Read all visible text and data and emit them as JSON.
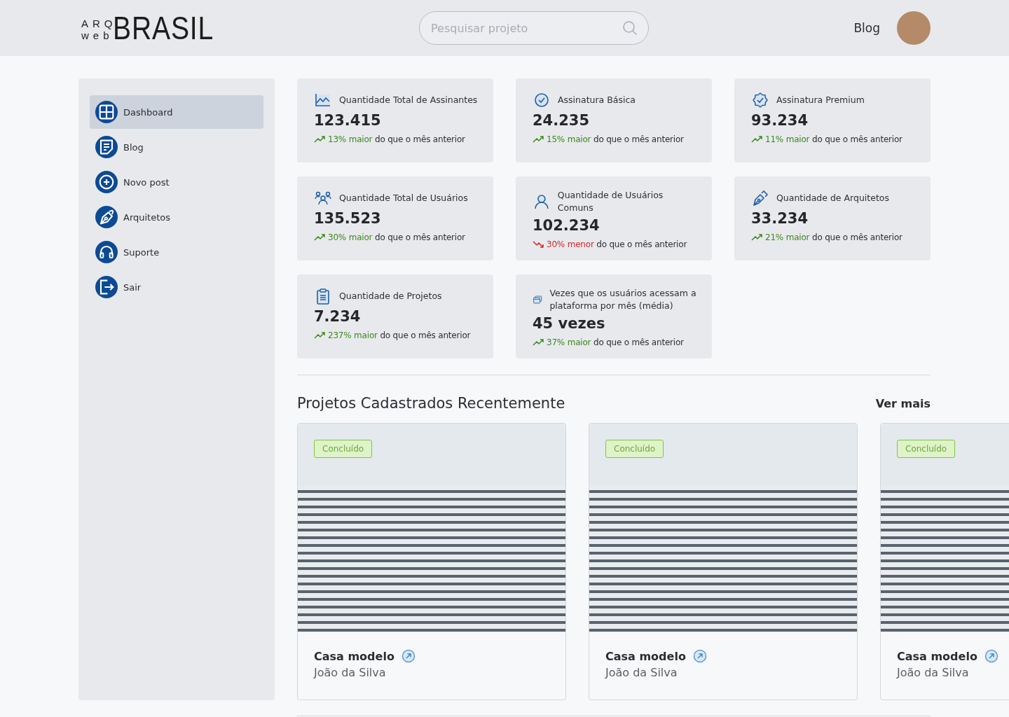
{
  "header": {
    "logo": {
      "top": "ARQ",
      "bottom": "web",
      "main": "BRASIL"
    },
    "search": {
      "placeholder": "Pesquisar projeto"
    },
    "nav_link": "Blog"
  },
  "sidebar": {
    "items": [
      {
        "label": "Dashboard",
        "kind": "grid",
        "selected": true
      },
      {
        "label": "Blog",
        "kind": "note",
        "selected": false
      },
      {
        "label": "Novo post",
        "kind": "plus",
        "selected": false
      },
      {
        "label": "Arquitetos",
        "kind": "pen",
        "selected": false
      },
      {
        "label": "Suporte",
        "kind": "headset",
        "selected": false
      },
      {
        "label": "Sair",
        "kind": "exit",
        "selected": false
      }
    ]
  },
  "stats": [
    {
      "kind": "chart",
      "title": "Quantidade Total de Assinantes",
      "value": "123.415",
      "rising": true,
      "change": "13% maior",
      "rest": "do que o mês anterior"
    },
    {
      "kind": "check",
      "title": "Assinatura Básica",
      "value": "24.235",
      "rising": true,
      "change": "15% maior",
      "rest": "do que o mês anterior"
    },
    {
      "kind": "badge",
      "title": "Assinatura Premium",
      "value": "93.234",
      "rising": true,
      "change": "11% maior",
      "rest": "do que o mês anterior"
    },
    {
      "kind": "users",
      "title": "Quantidade Total de Usuários",
      "value": "135.523",
      "rising": true,
      "change": "30% maior",
      "rest": "do que o mês anterior"
    },
    {
      "kind": "user",
      "title": "Quantidade de Usuários Comuns",
      "value": "102.234",
      "rising": false,
      "change": "30% menor",
      "rest": "do que o mês anterior"
    },
    {
      "kind": "pen",
      "title": "Quantidade de Arquitetos",
      "value": "33.234",
      "rising": true,
      "change": "21% maior",
      "rest": "do que o mês anterior"
    },
    {
      "kind": "clipboard",
      "title": "Quantidade de Projetos",
      "value": "7.234",
      "rising": true,
      "change": "237% maior",
      "rest": "do que o mês anterior"
    },
    {
      "kind": "windows",
      "title": "Vezes que os usuários acessam a plataforma por mês (média)",
      "value": "45 vezes",
      "rising": true,
      "change": "37% maior",
      "rest": "do que o mês anterior"
    }
  ],
  "projects": {
    "title": "Projetos Cadastrados Recentemente",
    "more": "Ver mais",
    "items": [
      {
        "status": "Concluído",
        "name": "Casa modelo",
        "author": "João da Silva"
      },
      {
        "status": "Concluído",
        "name": "Casa modelo",
        "author": "João da Silva"
      },
      {
        "status": "Concluído",
        "name": "Casa modelo",
        "author": "João da Silva"
      }
    ]
  }
}
